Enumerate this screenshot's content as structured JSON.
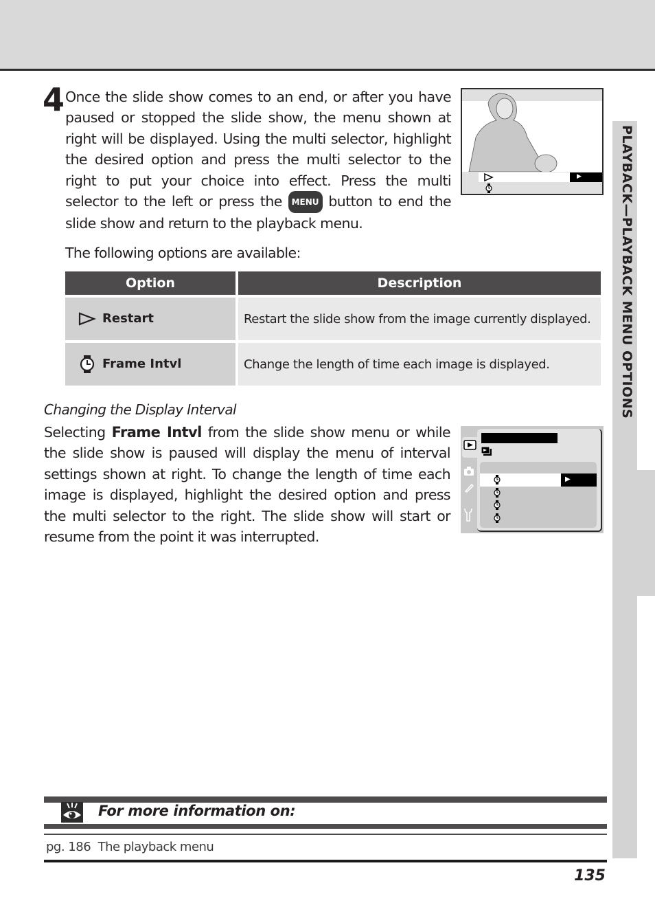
{
  "side_tab": {
    "label": "PLAYBACK—PLAYBACK MENU OPTIONS"
  },
  "step": {
    "number": "4",
    "text_before_icon": "Once the slide show comes to an end, or after you have paused or stopped the slide show, the menu shown at right will be displayed.  Using the multi selector, highlight the desired option and press the multi selector to the right to put your choice into effect.  Press the multi selector to the left or press the ",
    "menu_icon_label": "MENU",
    "text_after_icon": " button to end the slide show and return to the playback menu."
  },
  "options_intro": "The following options are available:",
  "options_table": {
    "headers": [
      "Option",
      "Description"
    ],
    "rows": [
      {
        "icon": "play-outline-icon",
        "option": "Restart",
        "description": "Restart the slide show from the image currently displayed."
      },
      {
        "icon": "watch-icon",
        "option": "Frame Intvl",
        "description": "Change the length of time each image is displayed."
      }
    ]
  },
  "subsection": {
    "title": "Changing the Display Interval",
    "text_before_bold": "Selecting ",
    "bold": "Frame Intvl",
    "text_after_bold": " from the slide show menu or while the slide show is paused will display the menu of interval settings shown at right.  To change the length of time each image is displayed, highlight the desired option and press the multi selector to the right. The slide show will start or resume from the point it was interrupted."
  },
  "info_box": {
    "icon": "eye-icon",
    "title": "For more information on:",
    "references": [
      {
        "page": "pg. 186",
        "topic": "The playback menu"
      }
    ]
  },
  "page_number": "135",
  "colors": {
    "header_dark": "#4d4b4c",
    "option_cell": "#d1d1d1",
    "desc_cell": "#e9e9e9",
    "side_tab": "#d3d3d3"
  }
}
